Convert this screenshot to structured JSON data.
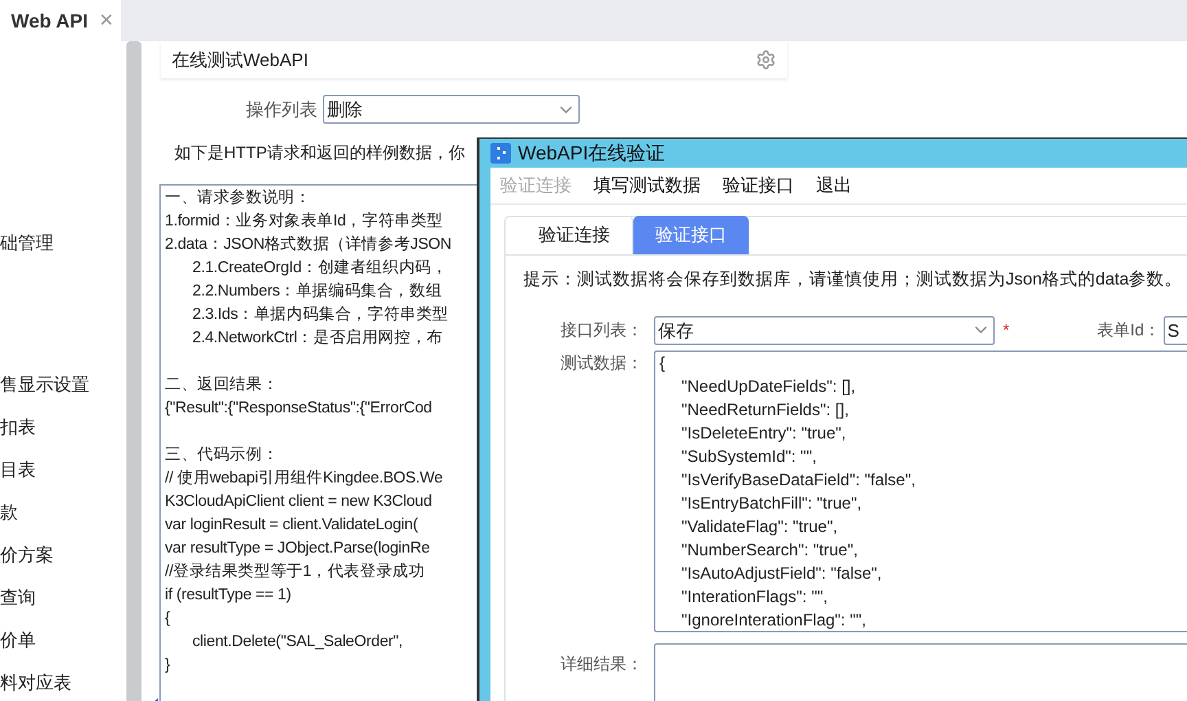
{
  "tab": {
    "title": "Web API",
    "close": "✕"
  },
  "sidebar": {
    "items": [
      "础管理",
      "售显示设置",
      "扣表",
      "目表",
      "款",
      "价方案",
      "查询",
      "价单",
      "料对应表"
    ]
  },
  "header": {
    "title": "在线测试WebAPI"
  },
  "operation": {
    "label": "操作列表",
    "value": "删除"
  },
  "intro": "如下是HTTP请求和返回的样例数据，你",
  "sample_sections": [
    {
      "lines": [
        {
          "text": "一、请求参数说明："
        },
        {
          "text": "1.formid：业务对象表单Id，字符串类型"
        },
        {
          "text": "2.data：JSON格式数据（详情参考JSON",
          "children": [
            {
              "text": "2.1.CreateOrgId：创建者组织内码，"
            },
            {
              "text": "2.2.Numbers：单据编码集合，数组"
            },
            {
              "text": "2.3.Ids：单据内码集合，字符串类型"
            },
            {
              "text": "2.4.NetworkCtrl：是否启用网控，布"
            }
          ]
        }
      ]
    },
    {
      "lines": [
        {
          "text": "二、返回结果："
        },
        {
          "text": "{\"Result\":{\"ResponseStatus\":{\"ErrorCod"
        }
      ]
    },
    {
      "lines": [
        {
          "text": "三、代码示例："
        },
        {
          "text": "// 使用webapi引用组件Kingdee.BOS.We"
        },
        {
          "text": "K3CloudApiClient client = new K3Cloud"
        },
        {
          "text": "var loginResult = client.ValidateLogin("
        },
        {
          "text": "var resultType = JObject.Parse(loginRe"
        },
        {
          "text": "//登录结果类型等于1，代表登录成功"
        },
        {
          "text": "if (resultType == 1)"
        },
        {
          "text": "{",
          "children": [
            {
              "text": "client.Delete(\"SAL_SaleOrder\","
            }
          ]
        },
        {
          "text": "}"
        }
      ]
    }
  ],
  "dialog": {
    "title": "WebAPI在线验证",
    "menu": [
      {
        "label": "验证连接",
        "disabled": true
      },
      {
        "label": "填写测试数据",
        "disabled": false
      },
      {
        "label": "验证接口",
        "disabled": false
      },
      {
        "label": "退出",
        "disabled": false
      }
    ],
    "tabs": [
      {
        "label": "验证连接",
        "selected": false
      },
      {
        "label": "验证接口",
        "selected": true
      }
    ],
    "hint": "提示：测试数据将会保存到数据库，请谨慎使用；测试数据为Json格式的data参数。",
    "api_list": {
      "label": "接口列表：",
      "value": "保存",
      "required": "*"
    },
    "form_id": {
      "label": "表单Id：",
      "value": "S"
    },
    "test_data": {
      "label": "测试数据：",
      "lines": [
        "{",
        "\"NeedUpDateFields\": [],",
        "\"NeedReturnFields\": [],",
        "\"IsDeleteEntry\": \"true\",",
        "\"SubSystemId\": \"\",",
        "\"IsVerifyBaseDataField\": \"false\",",
        "\"IsEntryBatchFill\": \"true\",",
        "\"ValidateFlag\": \"true\",",
        "\"NumberSearch\": \"true\",",
        "\"IsAutoAdjustField\": \"false\",",
        "\"InterationFlags\": \"\",",
        "\"IgnoreInterationFlag\": \"\","
      ]
    },
    "result": {
      "label": "详细结果："
    }
  }
}
